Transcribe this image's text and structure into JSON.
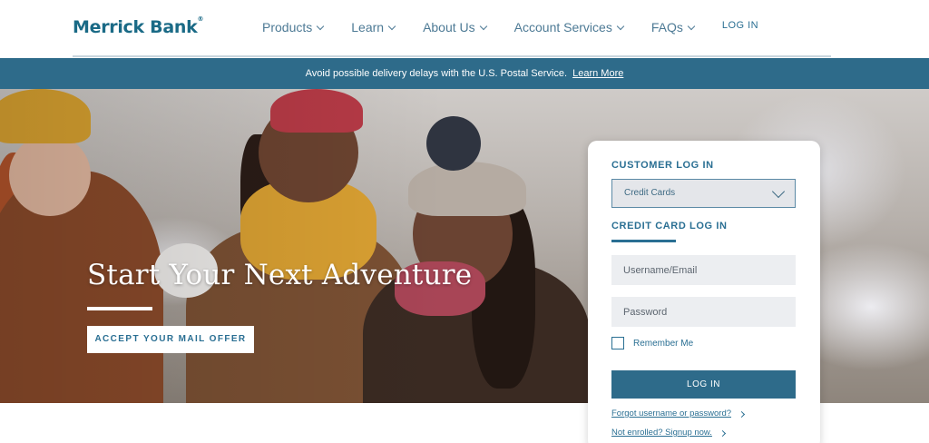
{
  "brand": {
    "name": "Merrick Bank",
    "mark": "®"
  },
  "nav": {
    "items": [
      {
        "label": "Products"
      },
      {
        "label": "Learn"
      },
      {
        "label": "About Us"
      },
      {
        "label": "Account Services"
      },
      {
        "label": "FAQs"
      }
    ],
    "login_label": "LOG IN"
  },
  "alert": {
    "text": "Avoid possible delivery delays with the U.S. Postal Service.",
    "link_label": "Learn More"
  },
  "hero": {
    "title": "Start Your Next Adventure",
    "cta_label": "ACCEPT YOUR MAIL OFFER"
  },
  "login_card": {
    "heading": "CUSTOMER LOG IN",
    "account_type": "Credit Cards",
    "subheading": "CREDIT CARD LOG IN",
    "username_placeholder": "Username/Email",
    "password_placeholder": "Password",
    "remember_label": "Remember Me",
    "submit_label": "LOG IN",
    "forgot_link": "Forgot username or password?",
    "enroll_link": "Not enrolled? Signup now."
  },
  "colors": {
    "brand": "#1a6a86",
    "nav_text": "#4d7a95",
    "alert_bg": "#2e6b8a",
    "button_bg": "#2e6b8a"
  }
}
